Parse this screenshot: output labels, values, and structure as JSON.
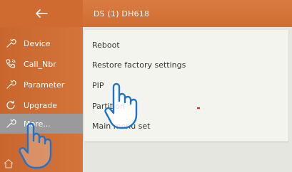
{
  "header": {
    "title": "DS (1) DH618"
  },
  "sidebar": {
    "back_icon": "arrow-left-icon",
    "items": [
      {
        "label": "Device",
        "icon": "wrench-icon"
      },
      {
        "label": "Call_Nbr",
        "icon": "phone-icon"
      },
      {
        "label": "Parameter",
        "icon": "wrench-icon"
      },
      {
        "label": "Upgrade",
        "icon": "refresh-icon"
      },
      {
        "label": "More...",
        "icon": "wrench-icon",
        "active": true
      }
    ],
    "home_icon": "home-icon"
  },
  "menu": {
    "items": [
      {
        "label": "Reboot"
      },
      {
        "label": "Restore factory settings"
      },
      {
        "label": "PIP"
      },
      {
        "label": "Partition"
      },
      {
        "label": "Main menu set"
      }
    ]
  },
  "colors": {
    "sidebar": "#d4743a",
    "header": "#d97c41",
    "active_item": "#9a9a9a",
    "hand_cursor": "#1f73c9"
  }
}
